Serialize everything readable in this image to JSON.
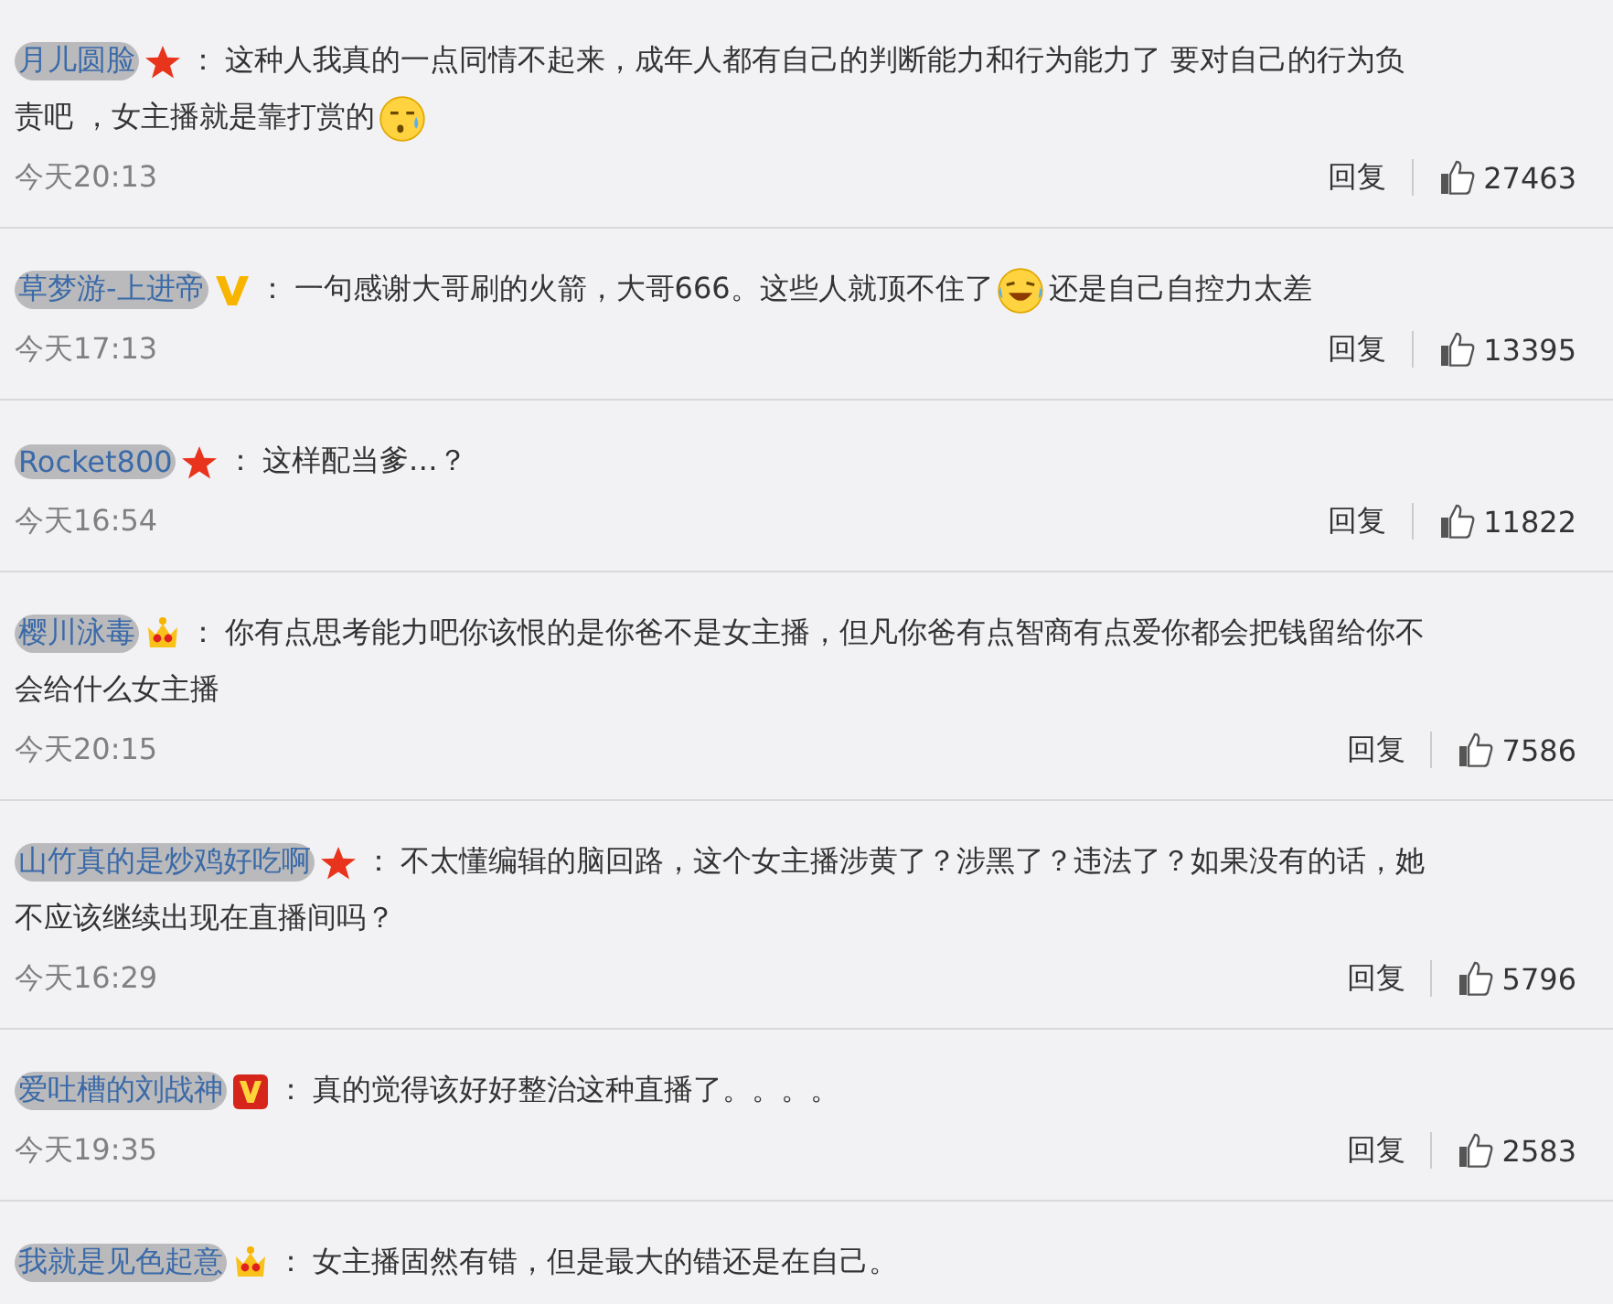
{
  "comments": [
    {
      "user": "月儿圆脸",
      "badge": {
        "kind": "star"
      },
      "separator": "：",
      "lines": [
        [
          {
            "kind": "text",
            "text": "这种人我真的一点同情不起来，成年人都有自己的判断能力和行为能力了 要对自己的行为负"
          }
        ],
        [
          {
            "kind": "text",
            "text": "责吧 ，女主播就是靠打赏的"
          },
          {
            "kind": "sweat_emoji"
          }
        ]
      ],
      "time": "今天20:13",
      "reply": "回复",
      "likes": "27463"
    },
    {
      "user": "草梦游-上进帝",
      "badge": {
        "kind": "v_yellow"
      },
      "separator": "：",
      "lines": [
        [
          {
            "kind": "text",
            "text": "一句感谢大哥刷的火箭，大哥666。这些人就顶不住了"
          },
          {
            "kind": "laugh_cry_emoji"
          },
          {
            "kind": "text",
            "text": "还是自己自控力太差"
          }
        ]
      ],
      "time": "今天17:13",
      "reply": "回复",
      "likes": "13395"
    },
    {
      "user": "Rocket800",
      "badge": {
        "kind": "star"
      },
      "separator": "：",
      "lines": [
        [
          {
            "kind": "text",
            "text": "这样配当爹…？"
          }
        ]
      ],
      "time": "今天16:54",
      "reply": "回复",
      "likes": "11822"
    },
    {
      "user": "樱川泳毒",
      "badge": {
        "kind": "crown"
      },
      "separator": "：",
      "lines": [
        [
          {
            "kind": "text",
            "text": "你有点思考能力吧你该恨的是你爸不是女主播，但凡你爸有点智商有点爱你都会把钱留给你不"
          }
        ],
        [
          {
            "kind": "text",
            "text": "会给什么女主播"
          }
        ]
      ],
      "time": "今天20:15",
      "reply": "回复",
      "likes": "7586"
    },
    {
      "user": "山竹真的是炒鸡好吃啊",
      "badge": {
        "kind": "star"
      },
      "separator": "：",
      "lines": [
        [
          {
            "kind": "text",
            "text": "不太懂编辑的脑回路，这个女主播涉黄了？涉黑了？违法了？如果没有的话，她"
          }
        ],
        [
          {
            "kind": "text",
            "text": "不应该继续出现在直播间吗？"
          }
        ]
      ],
      "time": "今天16:29",
      "reply": "回复",
      "likes": "5796"
    },
    {
      "user": "爱吐槽的刘战神",
      "badge": {
        "kind": "v_red"
      },
      "separator": "：",
      "lines": [
        [
          {
            "kind": "text",
            "text": "真的觉得该好好整治这种直播了。。。。"
          }
        ]
      ],
      "time": "今天19:35",
      "reply": "回复",
      "likes": "2583"
    },
    {
      "user": "我就是见色起意",
      "badge": {
        "kind": "crown"
      },
      "separator": "：",
      "lines": [
        [
          {
            "kind": "text",
            "text": "女主播固然有错，但是最大的错还是在自己。"
          }
        ]
      ]
    }
  ]
}
